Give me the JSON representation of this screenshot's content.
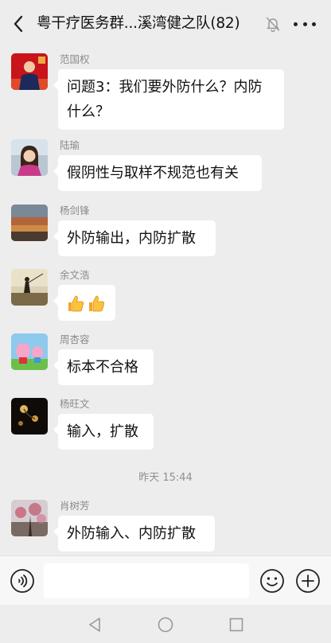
{
  "header": {
    "title": "粤干疗医务群...溪湾健之队(82)",
    "back_icon": "chevron-left-icon",
    "mute_icon": "bell-muted-icon",
    "more_icon": "more-dots-icon"
  },
  "messages": [
    {
      "sender": "范国权",
      "lines": [
        "问题3：我们要外防什么？内防",
        "什么？"
      ]
    },
    {
      "sender": "陆瑜",
      "text": "假阴性与取样不规范也有关"
    },
    {
      "sender": "杨剑锋",
      "text": "外防输出，内防扩散"
    },
    {
      "sender": "余文浩",
      "emoji": [
        "thumbs-up-icon",
        "thumbs-up-icon"
      ]
    },
    {
      "sender": "周杏容",
      "text": "标本不合格"
    },
    {
      "sender": "杨旺文",
      "text": "输入，扩散"
    },
    {
      "sender": "肖树芳",
      "text": "外防输入、内防扩散"
    }
  ],
  "timestamp": "昨天 15:44",
  "input": {
    "value": "",
    "placeholder": ""
  },
  "colors": {
    "background": "#ededed",
    "bubble": "#ffffff",
    "sender": "#8a8a8a"
  }
}
